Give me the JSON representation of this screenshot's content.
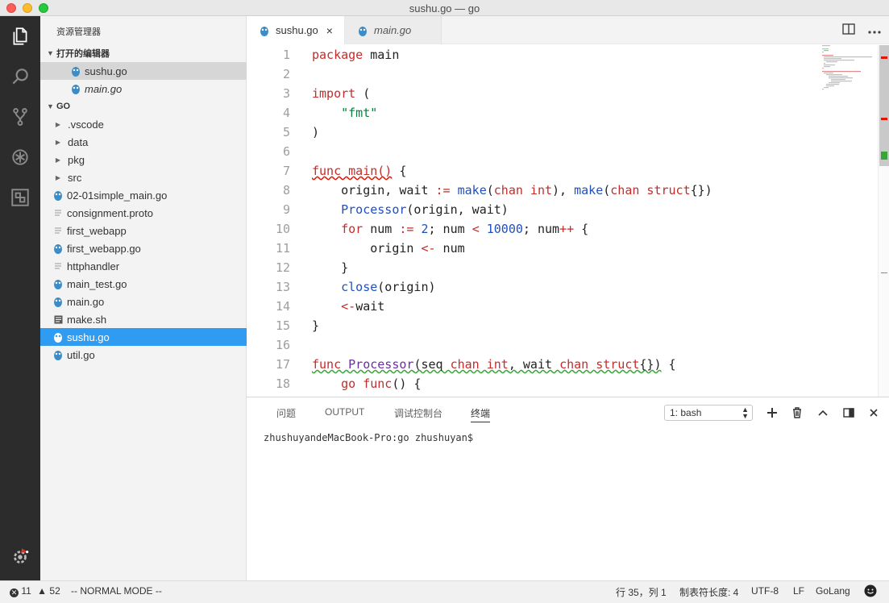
{
  "window": {
    "title": "sushu.go — go"
  },
  "activity_bar": {
    "items": [
      {
        "icon": "files-icon"
      },
      {
        "icon": "search-icon"
      },
      {
        "icon": "source-control-icon"
      },
      {
        "icon": "debug-icon"
      },
      {
        "icon": "extensions-icon"
      }
    ],
    "bottom_icon": "settings-gear-icon"
  },
  "sidebar": {
    "title": "资源管理器",
    "open_editors": {
      "label": "打开的编辑器",
      "items": [
        {
          "name": "sushu.go"
        },
        {
          "name": "main.go"
        }
      ]
    },
    "folder": {
      "label": "GO",
      "items": [
        {
          "name": ".vscode",
          "type": "folder"
        },
        {
          "name": "data",
          "type": "folder"
        },
        {
          "name": "pkg",
          "type": "folder"
        },
        {
          "name": "src",
          "type": "folder"
        },
        {
          "name": "02-01simple_main.go",
          "type": "go"
        },
        {
          "name": "consignment.proto",
          "type": "text"
        },
        {
          "name": "first_webapp",
          "type": "text"
        },
        {
          "name": "first_webapp.go",
          "type": "go"
        },
        {
          "name": "httphandler",
          "type": "text"
        },
        {
          "name": "main_test.go",
          "type": "go"
        },
        {
          "name": "main.go",
          "type": "go"
        },
        {
          "name": "make.sh",
          "type": "shell"
        },
        {
          "name": "sushu.go",
          "type": "go"
        },
        {
          "name": "util.go",
          "type": "go"
        }
      ]
    }
  },
  "tabs": [
    {
      "label": "sushu.go",
      "close": "×"
    },
    {
      "label": "main.go"
    }
  ],
  "editor": {
    "line_numbers": [
      "1",
      "2",
      "3",
      "4",
      "5",
      "6",
      "7",
      "8",
      "9",
      "10",
      "11",
      "12",
      "13",
      "14",
      "15",
      "16",
      "17",
      "18"
    ],
    "tokens": {
      "l1": [
        "package",
        " main"
      ],
      "l3": [
        "import",
        " ("
      ],
      "l4": [
        "    ",
        "\"fmt\""
      ],
      "l5": [
        ")"
      ],
      "l7": [
        "func main()",
        " {"
      ],
      "l8": [
        "    origin, wait ",
        ":=",
        " ",
        "make",
        "(",
        "chan int",
        "), ",
        "make",
        "(",
        "chan struct",
        "{})"
      ],
      "l9": [
        "    ",
        "Processor",
        "(origin, wait)"
      ],
      "l10": [
        "    ",
        "for",
        " num ",
        ":=",
        " ",
        "2",
        "; num ",
        "<",
        " ",
        "10000",
        "; num",
        "++",
        " {"
      ],
      "l11": [
        "        origin ",
        "<-",
        " num"
      ],
      "l12": [
        "    }"
      ],
      "l13": [
        "    ",
        "close",
        "(origin)"
      ],
      "l14": [
        "    ",
        "<-",
        "wait"
      ],
      "l15": [
        "}"
      ],
      "l17": [
        "func",
        " ",
        "Processor",
        "(seq ",
        "chan int",
        ", wait ",
        "chan struct",
        "{})",
        " {"
      ],
      "l18": [
        "    ",
        "go func",
        "() {"
      ]
    }
  },
  "panel": {
    "tabs": [
      "问题",
      "OUTPUT",
      "调试控制台",
      "终端"
    ],
    "active_tab": "终端",
    "terminal_select": "1: bash",
    "terminal_text": "zhushuyandeMacBook-Pro:go zhushuyan$"
  },
  "status": {
    "errors": "11",
    "warnings": "52",
    "mode": "-- NORMAL MODE --",
    "position": "行 35，列 1",
    "indent": "制表符长度: 4",
    "encoding": "UTF-8",
    "eol": "LF",
    "language": "GoLang",
    "feedback_icon": "smiley-icon"
  },
  "colors": {
    "accent_blue": "#2f9cf2",
    "keyword_red": "#c42b2b",
    "builtin_blue": "#1f4fbf",
    "string_green": "#0a7d3f",
    "activity_bg": "#2c2c2c"
  }
}
